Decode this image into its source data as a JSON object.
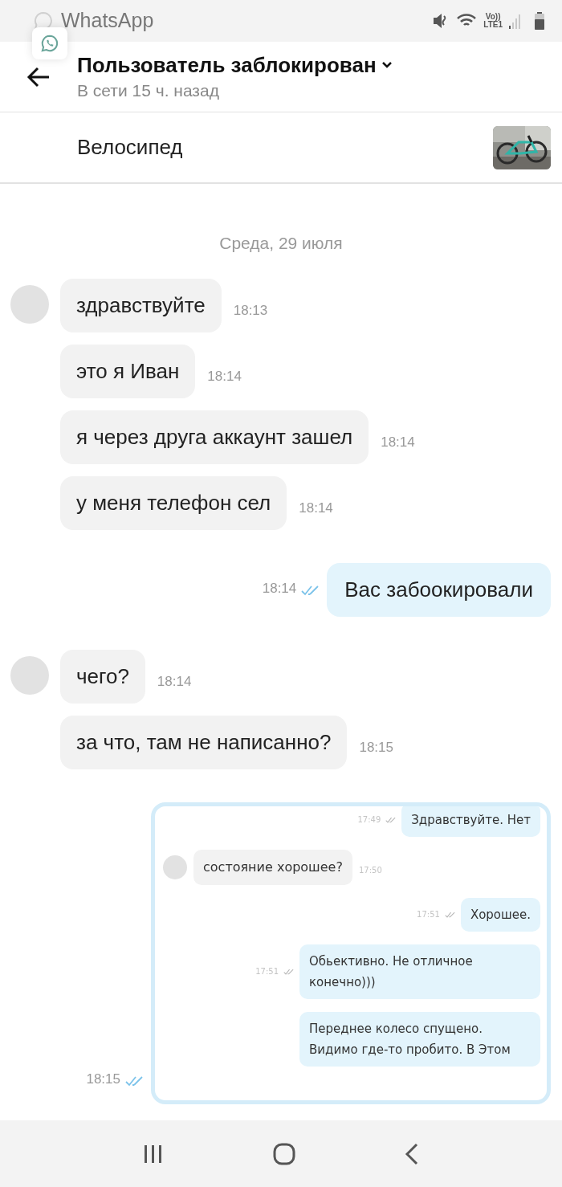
{
  "status_bar": {
    "app": "WhatsApp",
    "volte": "Vo))",
    "network": "LTE1"
  },
  "header": {
    "title": "Пользователь заблокирован",
    "subtitle": "В сети 15 ч. назад"
  },
  "listing": {
    "title": "Велосипед"
  },
  "date": "Среда, 29 июля",
  "messages": [
    {
      "kind": "text",
      "outgoing": false,
      "avatar": true,
      "text": "здравствуйте",
      "time": "18:13"
    },
    {
      "kind": "text",
      "outgoing": false,
      "avatar": false,
      "text": "это я Иван",
      "time": "18:14"
    },
    {
      "kind": "text",
      "outgoing": false,
      "avatar": false,
      "text": "я через друга аккаунт зашел",
      "time": "18:14"
    },
    {
      "kind": "text",
      "outgoing": false,
      "avatar": false,
      "text": "у меня телефон сел",
      "time": "18:14"
    },
    {
      "kind": "text",
      "outgoing": true,
      "read": true,
      "text": "Вас забоокировали",
      "time": "18:14"
    },
    {
      "kind": "text",
      "outgoing": false,
      "avatar": true,
      "text": "чего?",
      "time": "18:14"
    },
    {
      "kind": "text",
      "outgoing": false,
      "avatar": false,
      "text": "за что, там не написанно?",
      "time": "18:15"
    },
    {
      "kind": "screenshot",
      "outgoing": true,
      "read": true,
      "time": "18:15",
      "screenshot": {
        "messages": [
          {
            "outgoing": true,
            "text": "Здравствуйте. Нет",
            "time": "17:49"
          },
          {
            "outgoing": false,
            "avatar": true,
            "text": "состояние хорошее?",
            "time": "17:50"
          },
          {
            "outgoing": true,
            "text": "Хорошее.",
            "time": "17:51"
          },
          {
            "outgoing": true,
            "text": "Обьективно. Не отличное конечно)))",
            "time": "17:51"
          },
          {
            "outgoing": true,
            "text": "Переднее колесо спущено. Видимо где-то пробито. В Этом"
          }
        ]
      }
    }
  ]
}
